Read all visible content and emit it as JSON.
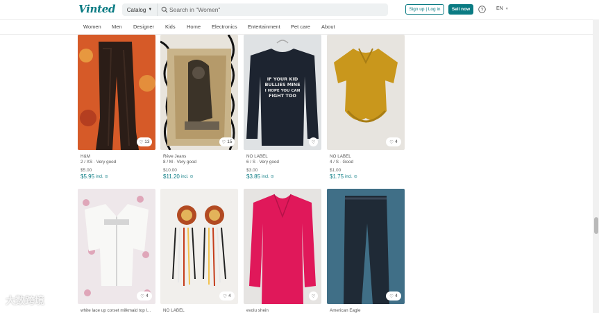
{
  "header": {
    "logo": "Vinted",
    "catalog_label": "Catalog",
    "search_placeholder": "Search in \"Women\"",
    "signup_label": "Sign up | Log in",
    "sell_label": "Sell now",
    "language": "EN"
  },
  "nav": [
    "Women",
    "Men",
    "Designer",
    "Kids",
    "Home",
    "Electronics",
    "Entertainment",
    "Pet care",
    "About"
  ],
  "items": [
    {
      "brand": "H&M",
      "meta": "2 / XS · Very good",
      "price": "$5.00",
      "total": "$5.95",
      "incl": "incl.",
      "favorites": "13"
    },
    {
      "brand": "Rêve Jeans",
      "meta": "8 / M · Very good",
      "price": "$10.00",
      "total": "$11.20",
      "incl": "incl.",
      "favorites": "15"
    },
    {
      "brand": "NO LABEL",
      "meta": "6 / S · Very good",
      "price": "$3.00",
      "total": "$3.85",
      "incl": "incl.",
      "favorites": ""
    },
    {
      "brand": "NO LABEL",
      "meta": "4 / S · Good",
      "price": "$1.00",
      "total": "$1.75",
      "incl": "incl.",
      "favorites": "4"
    },
    {
      "brand": "white lace up corset milkmaid top l...",
      "favorites": "4"
    },
    {
      "brand": "NO LABEL",
      "favorites": "4"
    },
    {
      "brand": "evolu shein",
      "favorites": ""
    },
    {
      "brand": "American Eagle",
      "favorites": "4"
    }
  ],
  "shirt_text": [
    "IF YOUR KID",
    "BULLIES MINE",
    "I HOPE YOU CAN",
    "FIGHT TOO"
  ],
  "watermark": "大数跨境",
  "colors": {
    "accent": "#0a7b83"
  }
}
